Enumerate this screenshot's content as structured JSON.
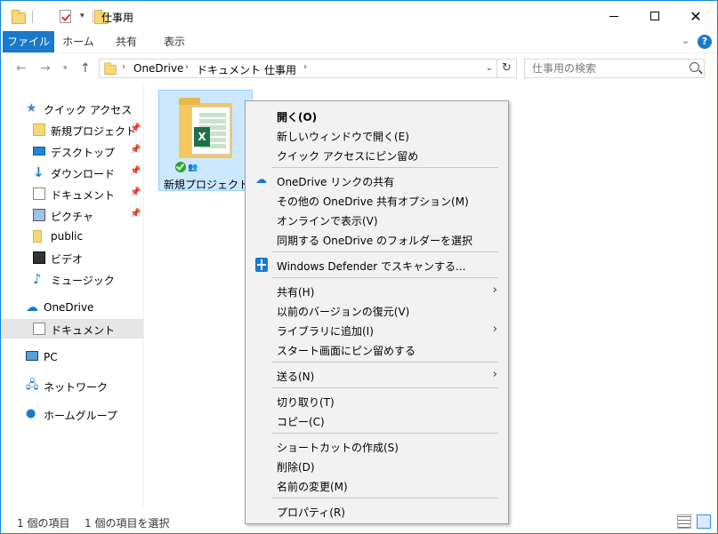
{
  "window": {
    "title": "仕事用",
    "accent_color": "#1979ca",
    "close_glyph": "✕"
  },
  "ribbon": {
    "tabs": [
      "ファイル",
      "ホーム",
      "共有",
      "表示"
    ],
    "help_label": "?"
  },
  "address": {
    "crumbs": [
      "OneDrive",
      "ドキュメント",
      "仕事用"
    ],
    "search_placeholder": "仕事用の検索"
  },
  "navpane": {
    "items": [
      {
        "label": "クイック アクセス",
        "icon": "star-icon"
      },
      {
        "label": "新規プロジェクト",
        "icon": "folder-icon",
        "pinned": true
      },
      {
        "label": "デスクトップ",
        "icon": "desktop-icon",
        "pinned": true
      },
      {
        "label": "ダウンロード",
        "icon": "download-icon",
        "pinned": true
      },
      {
        "label": "ドキュメント",
        "icon": "document-icon",
        "pinned": true
      },
      {
        "label": "ピクチャ",
        "icon": "pictures-icon",
        "pinned": true
      },
      {
        "label": "public",
        "icon": "folder-icon"
      },
      {
        "label": "ビデオ",
        "icon": "video-icon"
      },
      {
        "label": "ミュージック",
        "icon": "music-icon"
      },
      {
        "label": "OneDrive",
        "icon": "cloud-icon"
      },
      {
        "label": "ドキュメント",
        "icon": "document-icon",
        "selected": true
      },
      {
        "label": "PC",
        "icon": "pc-icon"
      },
      {
        "label": "ネットワーク",
        "icon": "network-icon"
      },
      {
        "label": "ホームグループ",
        "icon": "homegroup-icon"
      }
    ]
  },
  "content": {
    "file": {
      "name": "新規プロジェクト",
      "excel_letter": "X"
    }
  },
  "context_menu": {
    "items": [
      {
        "label": "開く(O)",
        "bold": true
      },
      {
        "label": "新しいウィンドウで開く(E)"
      },
      {
        "label": "クイック アクセスにピン留め"
      },
      {
        "label": "OneDrive リンクの共有",
        "icon": "onedrive-icon"
      },
      {
        "label": "その他の OneDrive 共有オプション(M)"
      },
      {
        "label": "オンラインで表示(V)"
      },
      {
        "label": "同期する OneDrive のフォルダーを選択"
      },
      {
        "label": "Windows Defender でスキャンする...",
        "icon": "defender-icon"
      },
      {
        "label": "共有(H)",
        "submenu": true
      },
      {
        "label": "以前のバージョンの復元(V)"
      },
      {
        "label": "ライブラリに追加(I)",
        "submenu": true
      },
      {
        "label": "スタート画面にピン留めする"
      },
      {
        "label": "送る(N)",
        "submenu": true
      },
      {
        "label": "切り取り(T)"
      },
      {
        "label": "コピー(C)"
      },
      {
        "label": "ショートカットの作成(S)"
      },
      {
        "label": "削除(D)"
      },
      {
        "label": "名前の変更(M)"
      },
      {
        "label": "プロパティ(R)"
      }
    ]
  },
  "statusbar": {
    "item_count": "1 個の項目",
    "selected_count": "1 個の項目を選択"
  }
}
